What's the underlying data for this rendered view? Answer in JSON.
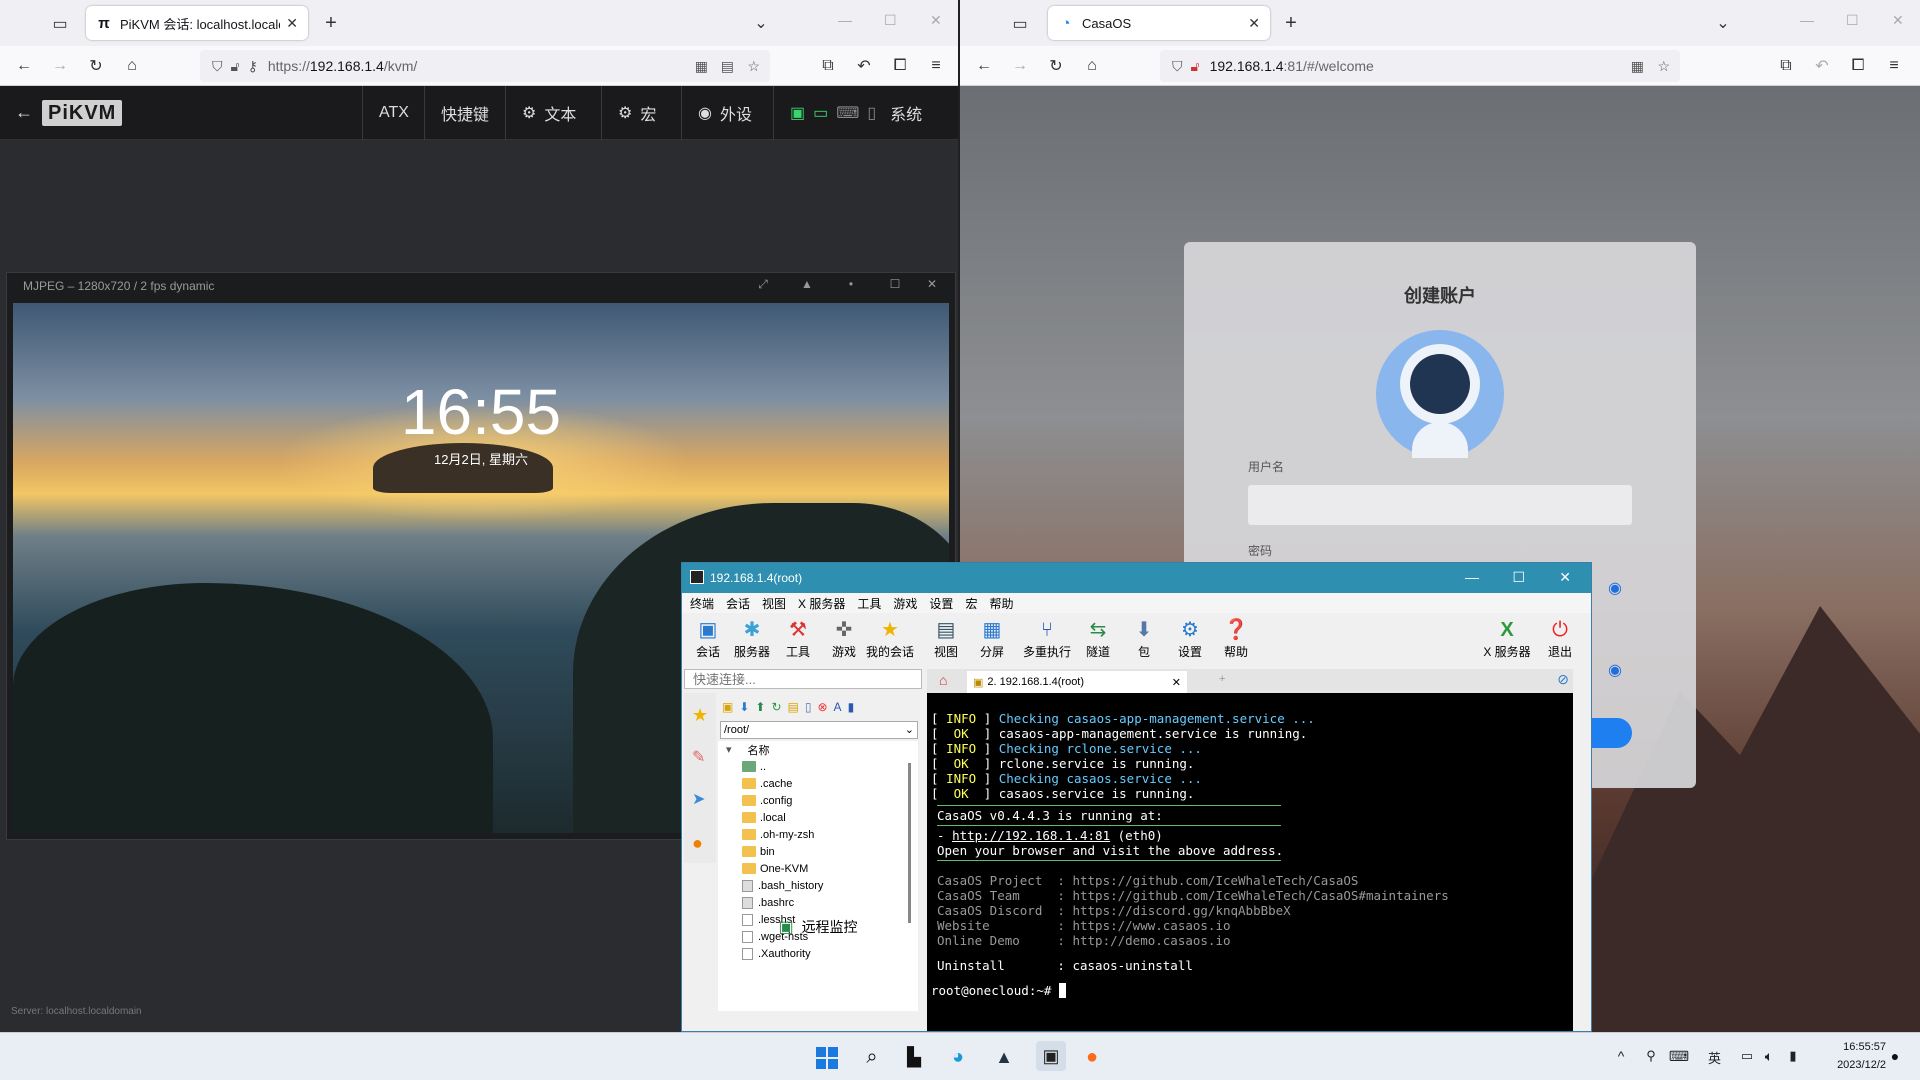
{
  "left_browser": {
    "tab_title": "PiKVM 会话:  localhost.localdo",
    "url_prefix": "https://",
    "url_host": "192.168.1.4",
    "url_path": "/kvm/"
  },
  "pikvm": {
    "logo": "PiKVM",
    "menu": [
      "ATX",
      "快捷键",
      "文本",
      "宏",
      "外设",
      "系统"
    ],
    "stream_title": "MJPEG – 1280x720 / 2 fps dynamic",
    "clock": "16:55",
    "date": "12月2日, 星期六",
    "server": "Server: localhost.localdomain"
  },
  "right_browser": {
    "tab_title": "CasaOS",
    "url_host": "192.168.1.4",
    "url_path": ":81/#/welcome"
  },
  "casaos": {
    "heading": "创建账户",
    "username_label": "用户名",
    "password_label": "密码"
  },
  "moba": {
    "title": "192.168.1.4(root)",
    "menu": [
      "终端",
      "会话",
      "视图",
      "X 服务器",
      "工具",
      "游戏",
      "设置",
      "宏",
      "帮助"
    ],
    "toolbar": [
      "会话",
      "服务器",
      "工具",
      "游戏",
      "我的会话",
      "视图",
      "分屏",
      "多重执行",
      "隧道",
      "包",
      "设置",
      "帮助"
    ],
    "toolbar_right": [
      "X 服务器",
      "退出"
    ],
    "quick_connect_placeholder": "快速连接...",
    "session_tab": "2. 192.168.1.4(root)",
    "path": "/root/",
    "tree_header": "名称",
    "files": [
      "..",
      ".cache",
      ".config",
      ".local",
      ".oh-my-zsh",
      "bin",
      "One-KVM",
      ".bash_history",
      ".bashrc",
      ".lesshst",
      ".wget-hsts",
      ".Xauthority"
    ],
    "remote_monitor": "远程监控",
    "terminal": [
      {
        "tag": "INFO",
        "text": "Checking casaos-app-management.service ..."
      },
      {
        "tag": " OK ",
        "text": "casaos-app-management.service is running."
      },
      {
        "tag": "INFO",
        "text": "Checking rclone.service ..."
      },
      {
        "tag": " OK ",
        "text": "rclone.service is running."
      },
      {
        "tag": "INFO",
        "text": "Checking casaos.service ..."
      },
      {
        "tag": " OK ",
        "text": "casaos.service is running."
      }
    ],
    "running_line": "CasaOS v0.4.4.3 is running at:",
    "address_line_prefix": "- ",
    "address_url": "http://192.168.1.4:81",
    "address_suffix": " (eth0)",
    "open_line": "Open your browser and visit the above address.",
    "info_lines": [
      "CasaOS Project  : https://github.com/IceWhaleTech/CasaOS",
      "CasaOS Team     : https://github.com/IceWhaleTech/CasaOS#maintainers",
      "CasaOS Discord  : https://discord.gg/knqAbbBbeX",
      "Website         : https://www.casaos.io",
      "Online Demo     : http://demo.casaos.io"
    ],
    "uninstall_line": "Uninstall       : casaos-uninstall",
    "prompt": "root@onecloud:~# "
  },
  "taskbar": {
    "ime": "英",
    "time": "16:55:57",
    "date": "2023/12/2"
  }
}
